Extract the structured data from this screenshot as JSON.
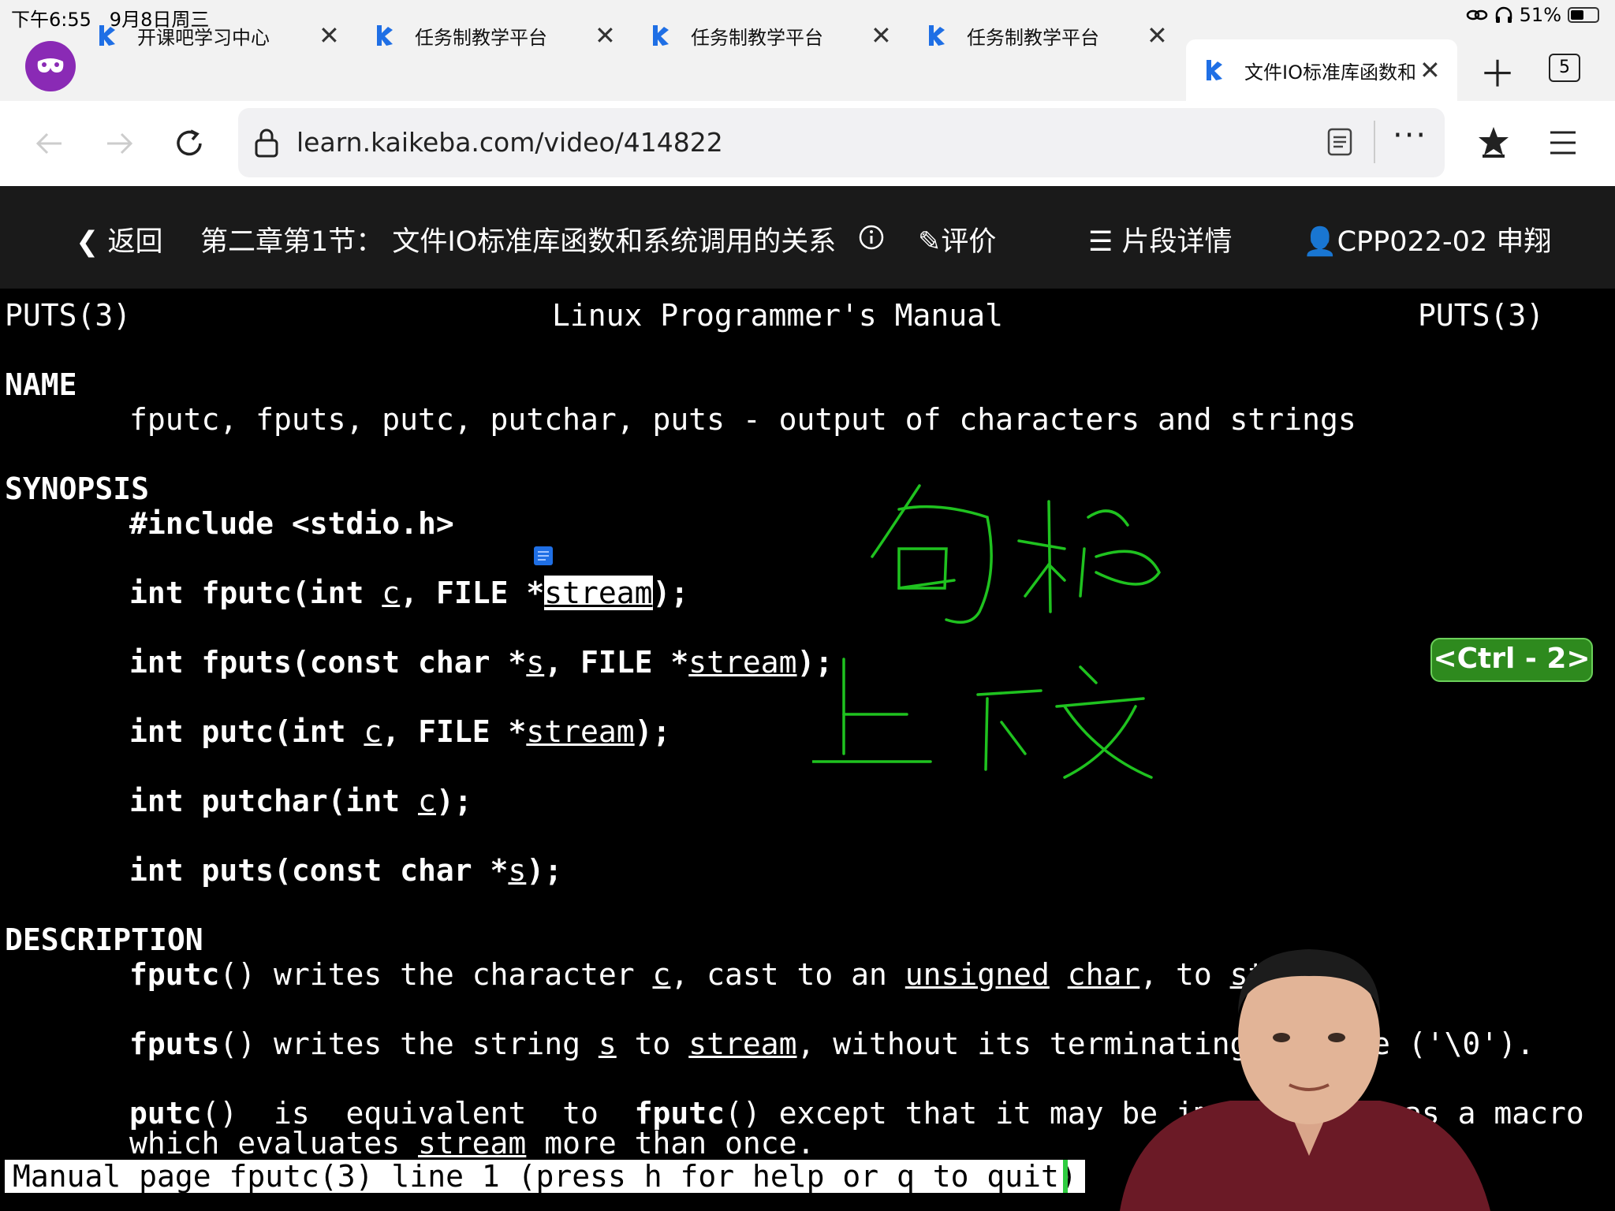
{
  "status": {
    "time": "下午6:55",
    "date": "9月8日周三",
    "battery": "51%",
    "battery_level": 0.51
  },
  "tabs": [
    {
      "label": "开课吧学习中心"
    },
    {
      "label": "任务制教学平台"
    },
    {
      "label": "任务制教学平台"
    },
    {
      "label": "任务制教学平台"
    },
    {
      "label": "文件IO标准库函数和"
    }
  ],
  "tab_count": "5",
  "address": {
    "url": "learn.kaikeba.com/video/414822"
  },
  "video_header": {
    "back": "返回",
    "title": "第二章第1节：  文件IO标准库函数和系统调用的关系",
    "review": "评价",
    "segments": "片段详情",
    "user": "CPP022-02 申翔"
  },
  "manpage": {
    "header_left": "PUTS(3)",
    "header_center": "Linux Programmer's Manual",
    "header_right": "PUTS(3)",
    "name_heading": "NAME",
    "name_line": "fputc, fputs, putc, putchar, puts - output of characters and strings",
    "synopsis_heading": "SYNOPSIS",
    "include": "#include <stdio.h>",
    "int1": "int fputc(int ",
    "c": "c",
    "comma_file": ", FILE *",
    "stream": "stream",
    "close_semi": ");",
    "int2": "int fputs(const char *",
    "s": "s",
    "int3": "int putc(int ",
    "int4": "int putchar(int ",
    "int5": "int puts(const char *",
    "desc_heading": "DESCRIPTION",
    "fputc": "fputc",
    "fputs": "fputs",
    "putc": "putc",
    "paren": "()",
    "d1a": " writes the character ",
    "d1b": ", cast to an ",
    "unsigned": "unsigned",
    "space": " ",
    "char": "char",
    "d1c": ", to ",
    "stre": "stre",
    "d2a": " writes the string ",
    "d2b": " to ",
    "d2c": ", without its terminating ",
    "d2d": "e ('\\0').",
    "d3a": "  is  equivalent  to  ",
    "d3b": " except that it may be implem",
    "d3c": "as a macro",
    "d4a": "which evaluates ",
    "d4b": " more than once.",
    "status_line": "Manual page fputc(3) line 1 (press h for help or q to quit)"
  },
  "overlay": {
    "ctrl_badge": "<Ctrl - 2>"
  }
}
